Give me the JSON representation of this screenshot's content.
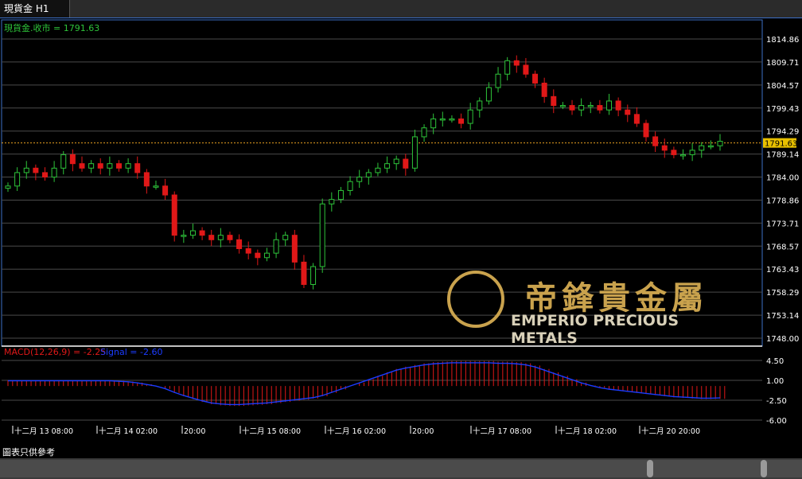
{
  "tab": {
    "title": "現貨金 H1"
  },
  "legend": {
    "close_label": "現貨金.收市 = 1791.63"
  },
  "price_axis": {
    "ticks": [
      "1814.86",
      "1809.71",
      "1804.57",
      "1799.43",
      "1794.29",
      "1789.14",
      "1784.00",
      "1778.86",
      "1773.71",
      "1768.57",
      "1763.43",
      "1758.29",
      "1753.14",
      "1748.00"
    ],
    "current": "1791.63"
  },
  "macd": {
    "label": "MACD(12,26,9) = -2.25",
    "signal_label": "Signal = -2.60",
    "ticks": [
      "4.50",
      "1.00",
      "-2.50",
      "-6.00"
    ]
  },
  "time_axis": [
    "十二月 13 08:00",
    "十二月 14 02:00",
    "20:00",
    "十二月 15 08:00",
    "十二月 16 02:00",
    "20:00",
    "十二月 17 08:00",
    "十二月 18 02:00",
    "十二月 20 20:00"
  ],
  "brand": {
    "cn": "帝鋒貴金屬",
    "en": "EMPERIO PRECIOUS METALS"
  },
  "footer": {
    "note": "圖表只供參考"
  },
  "colors": {
    "up": "#2ec43a",
    "down": "#e01818",
    "grid": "#4a4a4a",
    "axis_text": "#ffffff",
    "price_line": "#e8a020",
    "signal": "#1b3cff"
  },
  "chart_data": {
    "type": "candlestick",
    "ylim": [
      1748.0,
      1814.86
    ],
    "close_path": [
      1782,
      1785,
      1786,
      1785,
      1784,
      1786,
      1789,
      1787,
      1786,
      1787,
      1786,
      1787,
      1786,
      1787,
      1785,
      1782,
      1782,
      1780,
      1771,
      1771,
      1772,
      1771,
      1770,
      1771,
      1770,
      1768,
      1767,
      1766,
      1767,
      1770,
      1771,
      1765,
      1760,
      1764,
      1778,
      1779,
      1781,
      1783,
      1784,
      1785,
      1786,
      1787,
      1788,
      1786,
      1793,
      1795,
      1797,
      1797,
      1797,
      1796,
      1799,
      1801,
      1804,
      1807,
      1810,
      1809,
      1807,
      1805,
      1802,
      1800,
      1800,
      1799,
      1800,
      1800,
      1799,
      1801,
      1799,
      1798,
      1796,
      1793,
      1791,
      1790,
      1789,
      1789,
      1790,
      1791,
      1791,
      1792
    ],
    "macd_hist": [
      1,
      1,
      1,
      1,
      1,
      1,
      1,
      1,
      1,
      1,
      1,
      1,
      0.9,
      0.8,
      0.6,
      0.3,
      0,
      -0.5,
      -1.2,
      -1.8,
      -2.3,
      -2.8,
      -3.2,
      -3.4,
      -3.5,
      -3.5,
      -3.4,
      -3.3,
      -3.2,
      -3.0,
      -2.8,
      -2.6,
      -2.4,
      -2.2,
      -1.8,
      -1.2,
      -0.6,
      0,
      0.6,
      1.2,
      1.8,
      2.4,
      3.0,
      3.4,
      3.7,
      4.0,
      4.2,
      4.3,
      4.4,
      4.4,
      4.4,
      4.4,
      4.4,
      4.3,
      4.3,
      4.2,
      4.0,
      3.6,
      3.0,
      2.4,
      1.8,
      1.2,
      0.6,
      0.1,
      -0.3,
      -0.6,
      -0.8,
      -1.0,
      -1.2,
      -1.4,
      -1.6,
      -1.8,
      -2.0,
      -2.1,
      -2.2,
      -2.3,
      -2.3,
      -2.25
    ],
    "series": [
      {
        "name": "MACD"
      },
      {
        "name": "Signal"
      }
    ]
  }
}
